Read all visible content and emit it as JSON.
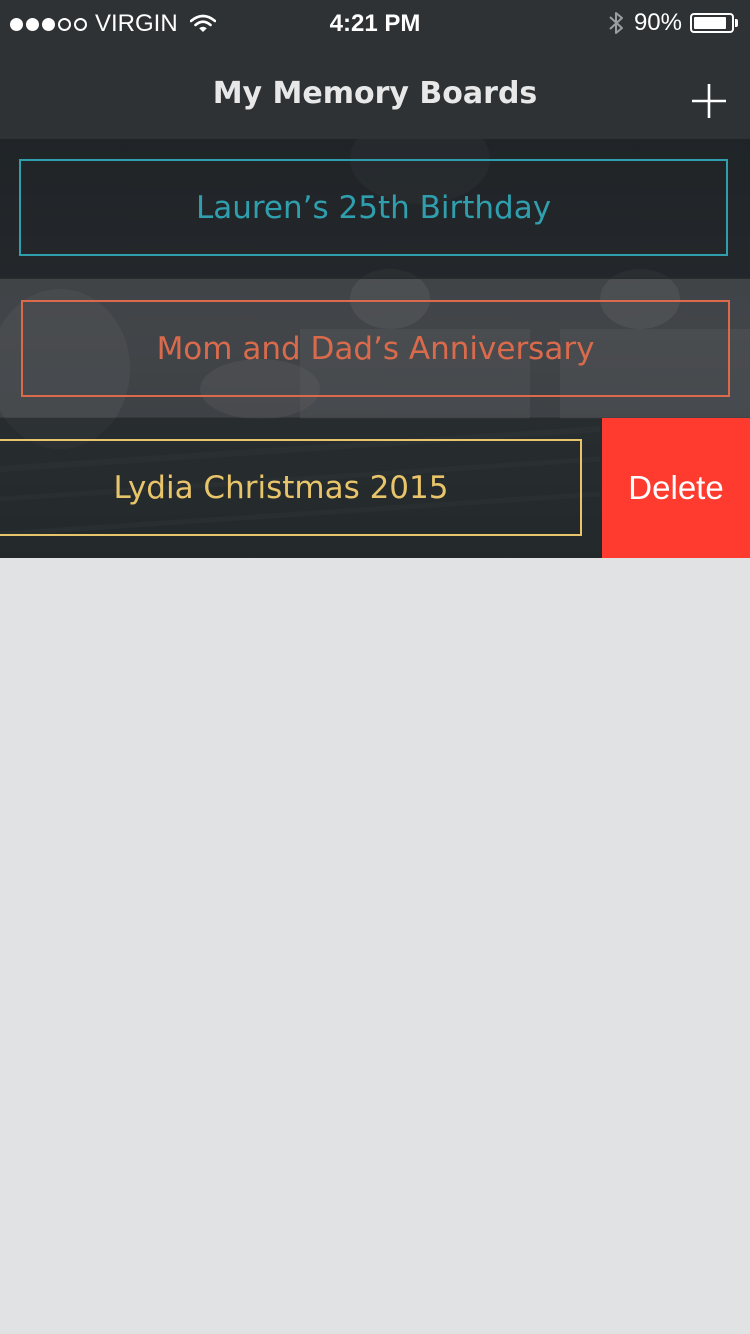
{
  "status_bar": {
    "signal_filled": 3,
    "signal_total": 5,
    "carrier": "VIRGIN",
    "time": "4:21 PM",
    "battery_percent_label": "90%",
    "battery_level": 0.9
  },
  "nav": {
    "title": "My Memory Boards",
    "add_icon": "plus-icon"
  },
  "boards": [
    {
      "title": "Lauren’s 25th Birthday",
      "color": "#2f9fae"
    },
    {
      "title": "Mom and Dad’s Anniversary",
      "color": "#d96a4c"
    },
    {
      "title": "Lydia Christmas 2015",
      "color": "#e8c46a"
    }
  ],
  "swipe_actions": {
    "delete_label": "Delete",
    "delete_color": "#ff3b30"
  },
  "colors": {
    "bar_background": "#2e3235",
    "empty_area": "#e1e2e4"
  }
}
